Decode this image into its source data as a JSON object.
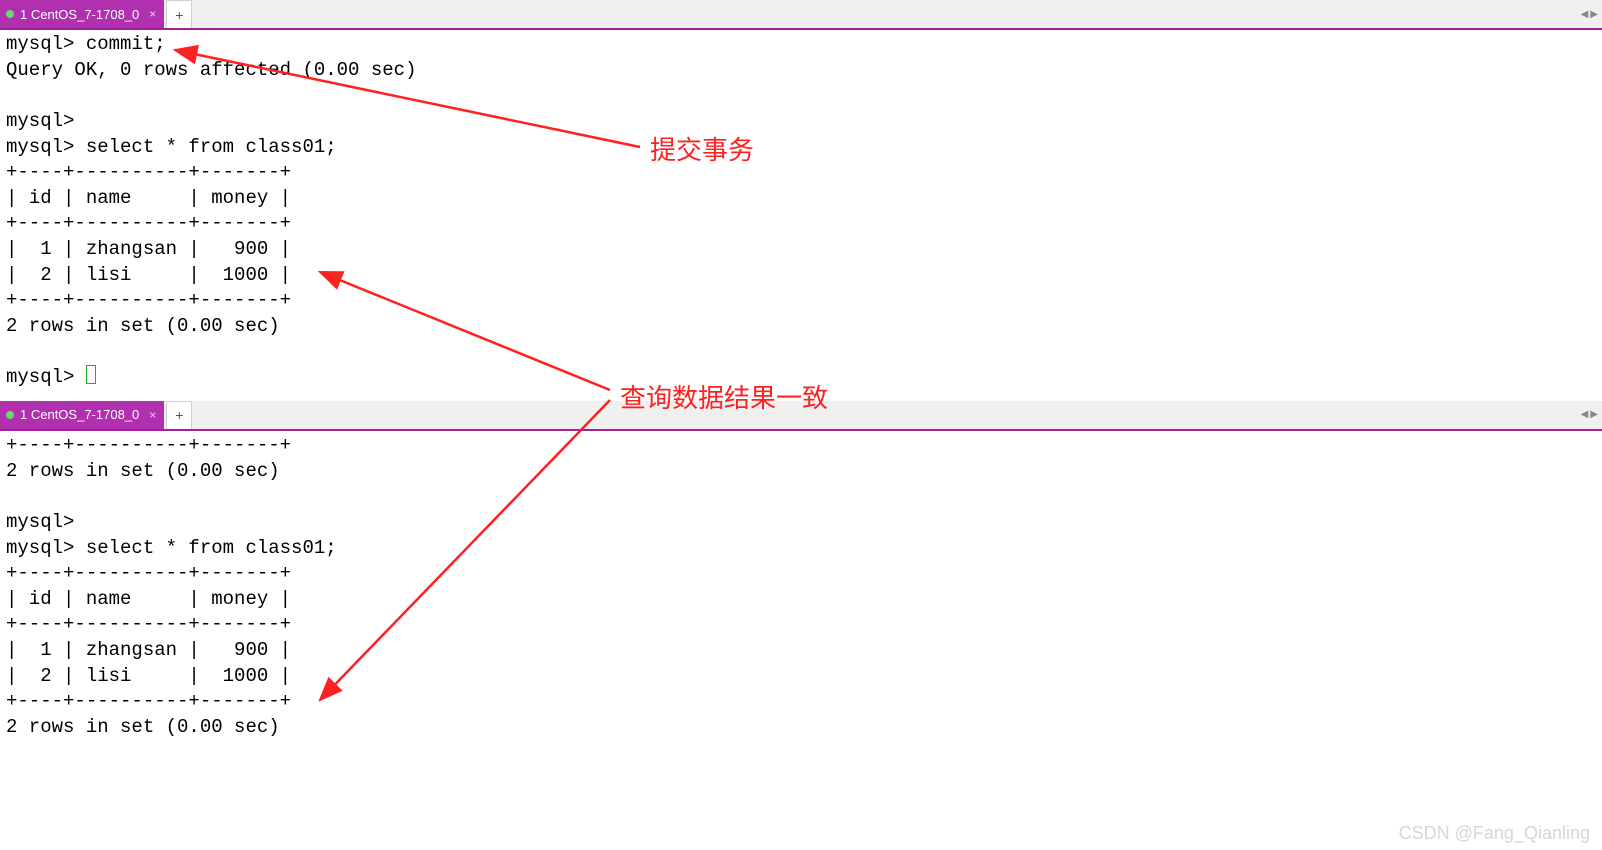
{
  "tabs": {
    "top_label": "1 CentOS_7-1708_0",
    "bottom_label": "1 CentOS_7-1708_0",
    "plus": "+",
    "close_glyph": "×",
    "arrow_left": "◀",
    "arrow_right": "▶"
  },
  "annotations": {
    "commit_label": "提交事务",
    "consistent_label": "查询数据结果一致"
  },
  "watermark": "CSDN @Fang_Qianling",
  "terminal_top": {
    "l1": "mysql> commit;",
    "l2": "Query OK, 0 rows affected (0.00 sec)",
    "l3": "",
    "l4": "mysql>",
    "l5": "mysql> select * from class01;",
    "l6": "+----+----------+-------+",
    "l7": "| id | name     | money |",
    "l8": "+----+----------+-------+",
    "l9": "|  1 | zhangsan |   900 |",
    "l10": "|  2 | lisi     |  1000 |",
    "l11": "+----+----------+-------+",
    "l12": "2 rows in set (0.00 sec)",
    "l13": "",
    "l14": "mysql> "
  },
  "terminal_bottom": {
    "l1": "+----+----------+-------+",
    "l2": "2 rows in set (0.00 sec)",
    "l3": "",
    "l4": "mysql>",
    "l5": "mysql> select * from class01;",
    "l6": "+----+----------+-------+",
    "l7": "| id | name     | money |",
    "l8": "+----+----------+-------+",
    "l9": "|  1 | zhangsan |   900 |",
    "l10": "|  2 | lisi     |  1000 |",
    "l11": "+----+----------+-------+",
    "l12": "2 rows in set (0.00 sec)"
  },
  "chart_data": {
    "type": "table",
    "title": "select * from class01",
    "columns": [
      "id",
      "name",
      "money"
    ],
    "rows": [
      {
        "id": 1,
        "name": "zhangsan",
        "money": 900
      },
      {
        "id": 2,
        "name": "lisi",
        "money": 1000
      }
    ],
    "row_count_text": "2 rows in set (0.00 sec)"
  }
}
